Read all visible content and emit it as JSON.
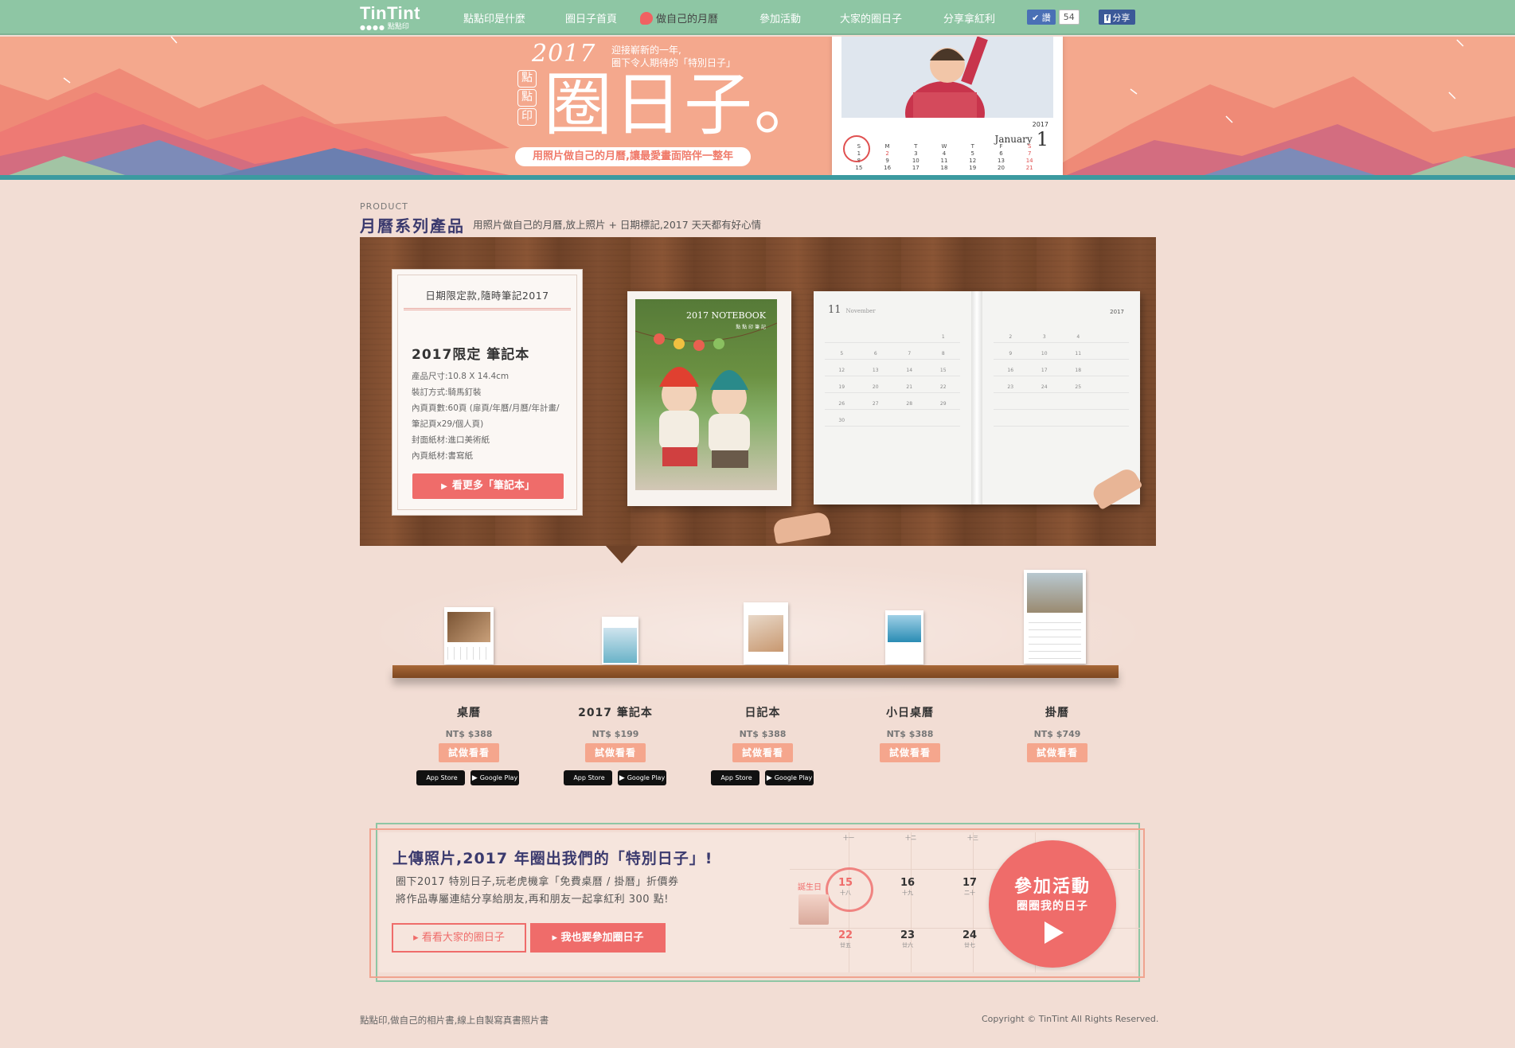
{
  "nav": {
    "logo": "TinTint",
    "logo_dots": "●●●●",
    "logo_cn": "點點印",
    "items": [
      {
        "label": "點點印是什麼"
      },
      {
        "label": "圈日子首頁"
      },
      {
        "label": "做自己的月曆"
      },
      {
        "label": "參加活動"
      },
      {
        "label": "大家的圈日子"
      },
      {
        "label": "分享拿紅利"
      }
    ],
    "like_label": "讚",
    "like_count": "54",
    "share_label": "分享"
  },
  "hero": {
    "year": "2017",
    "sub1": "迎接嶄新的一年,",
    "sub2": "圈下令人期待的「特別日子」",
    "stamp": [
      "點",
      "點",
      "印"
    ],
    "big_title": "圈日子。",
    "pill": "用照片做自己的月曆,讓最愛畫面陪伴一整年",
    "cal_year": "2017",
    "cal_month": "January",
    "cal_num": "1",
    "cal_weekdays": [
      "S",
      "M",
      "T",
      "W",
      "T",
      "F",
      "S"
    ],
    "cal_rows": [
      [
        "1",
        "2",
        "3",
        "4",
        "5",
        "6",
        "7"
      ],
      [
        "8",
        "9",
        "10",
        "11",
        "12",
        "13",
        "14"
      ],
      [
        "15",
        "16",
        "17",
        "18",
        "19",
        "20",
        "21"
      ]
    ]
  },
  "product": {
    "eyebrow": "PRODUCT",
    "title": "月曆系列產品",
    "desc": "用照片做自己的月曆,放上照片 + 日期標記,2017 天天都有好心情"
  },
  "feature": {
    "kicker": "日期限定款,隨時筆記2017",
    "title": "2017限定 筆記本",
    "specs": [
      "產品尺寸:10.8 X 14.4cm",
      "裝訂方式:騎馬釘裝",
      "內頁頁數:60頁 (扉頁/年曆/月曆/年計畫/筆記頁x29/個人頁)",
      "封面紙材:進口美術紙",
      "內頁紙材:書寫紙"
    ],
    "button": "看更多「筆記本」",
    "notebook_title": "2017 NOTEBOOK",
    "notebook_sub": "點 點 印 筆 記",
    "planner_month": "11",
    "planner_month_name": "November",
    "planner_year": "2017",
    "planner_rows_left": [
      [
        "",
        "",
        "",
        "1"
      ],
      [
        "5",
        "6",
        "7",
        "8"
      ],
      [
        "12",
        "13",
        "14",
        "15"
      ],
      [
        "19",
        "20",
        "21",
        "22"
      ],
      [
        "26",
        "27",
        "28",
        "29"
      ],
      [
        "30",
        "",
        "",
        ""
      ]
    ],
    "planner_rows_right": [
      [
        "2",
        "3",
        "4",
        ""
      ],
      [
        "9",
        "10",
        "11",
        ""
      ],
      [
        "16",
        "17",
        "18",
        ""
      ],
      [
        "23",
        "24",
        "25",
        ""
      ],
      [
        "",
        "",
        "",
        ""
      ],
      [
        "",
        "",
        "",
        ""
      ]
    ]
  },
  "shelf": {
    "products": [
      {
        "name": "桌曆",
        "price": "NT$ $388",
        "try": "試做看看",
        "apps": true
      },
      {
        "name": "2017 筆記本",
        "price": "NT$ $199",
        "try": "試做看看",
        "apps": true
      },
      {
        "name": "日記本",
        "price": "NT$ $388",
        "try": "試做看看",
        "apps": true
      },
      {
        "name": "小日桌曆",
        "price": "NT$ $388",
        "try": "試做看看",
        "apps": false
      },
      {
        "name": "掛曆",
        "price": "NT$ $749",
        "try": "試做看看",
        "apps": false
      }
    ],
    "app_store": "App Store",
    "google_play": "Google Play"
  },
  "event": {
    "title": "上傳照片,2017 年圈出我們的「特別日子」!",
    "line1": "圈下2017 特別日子,玩老虎機拿「免費桌曆 / 掛曆」折價券",
    "line2": "將作品專屬連結分享給朋友,再和朋友一起拿紅利 300 點!",
    "btn_view": "看看大家的圈日子",
    "btn_join": "我也要參加圈日子",
    "bday_label": "誕生日",
    "days": [
      {
        "n": "15",
        "s": "十八",
        "red": true
      },
      {
        "n": "16",
        "s": "十九",
        "red": false
      },
      {
        "n": "17",
        "s": "二十",
        "red": false
      },
      {
        "n": "22",
        "s": "廿五",
        "red": true
      },
      {
        "n": "23",
        "s": "廿六",
        "red": false
      },
      {
        "n": "24",
        "s": "廿七",
        "red": false
      }
    ],
    "top_subs": [
      "十一",
      "十二",
      "十三"
    ],
    "join_line1": "參加活動",
    "join_line2": "圈圈我的日子"
  },
  "footer": {
    "left": "點點印,做自己的相片書,線上自製寫真書照片書",
    "right": "Copyright © TinTint All Rights Reserved."
  },
  "colors": {
    "nav_bg": "#8ec6a4",
    "hero_bg": "#f4a88d",
    "page_bg": "#f2ddd4",
    "accent": "#ef6c6a",
    "title_navy": "#3b3a6e",
    "teal_line": "#3c9aa0"
  },
  "icons": [
    "apple-icon",
    "google-play-icon",
    "play-icon",
    "facebook-icon",
    "like-icon"
  ]
}
